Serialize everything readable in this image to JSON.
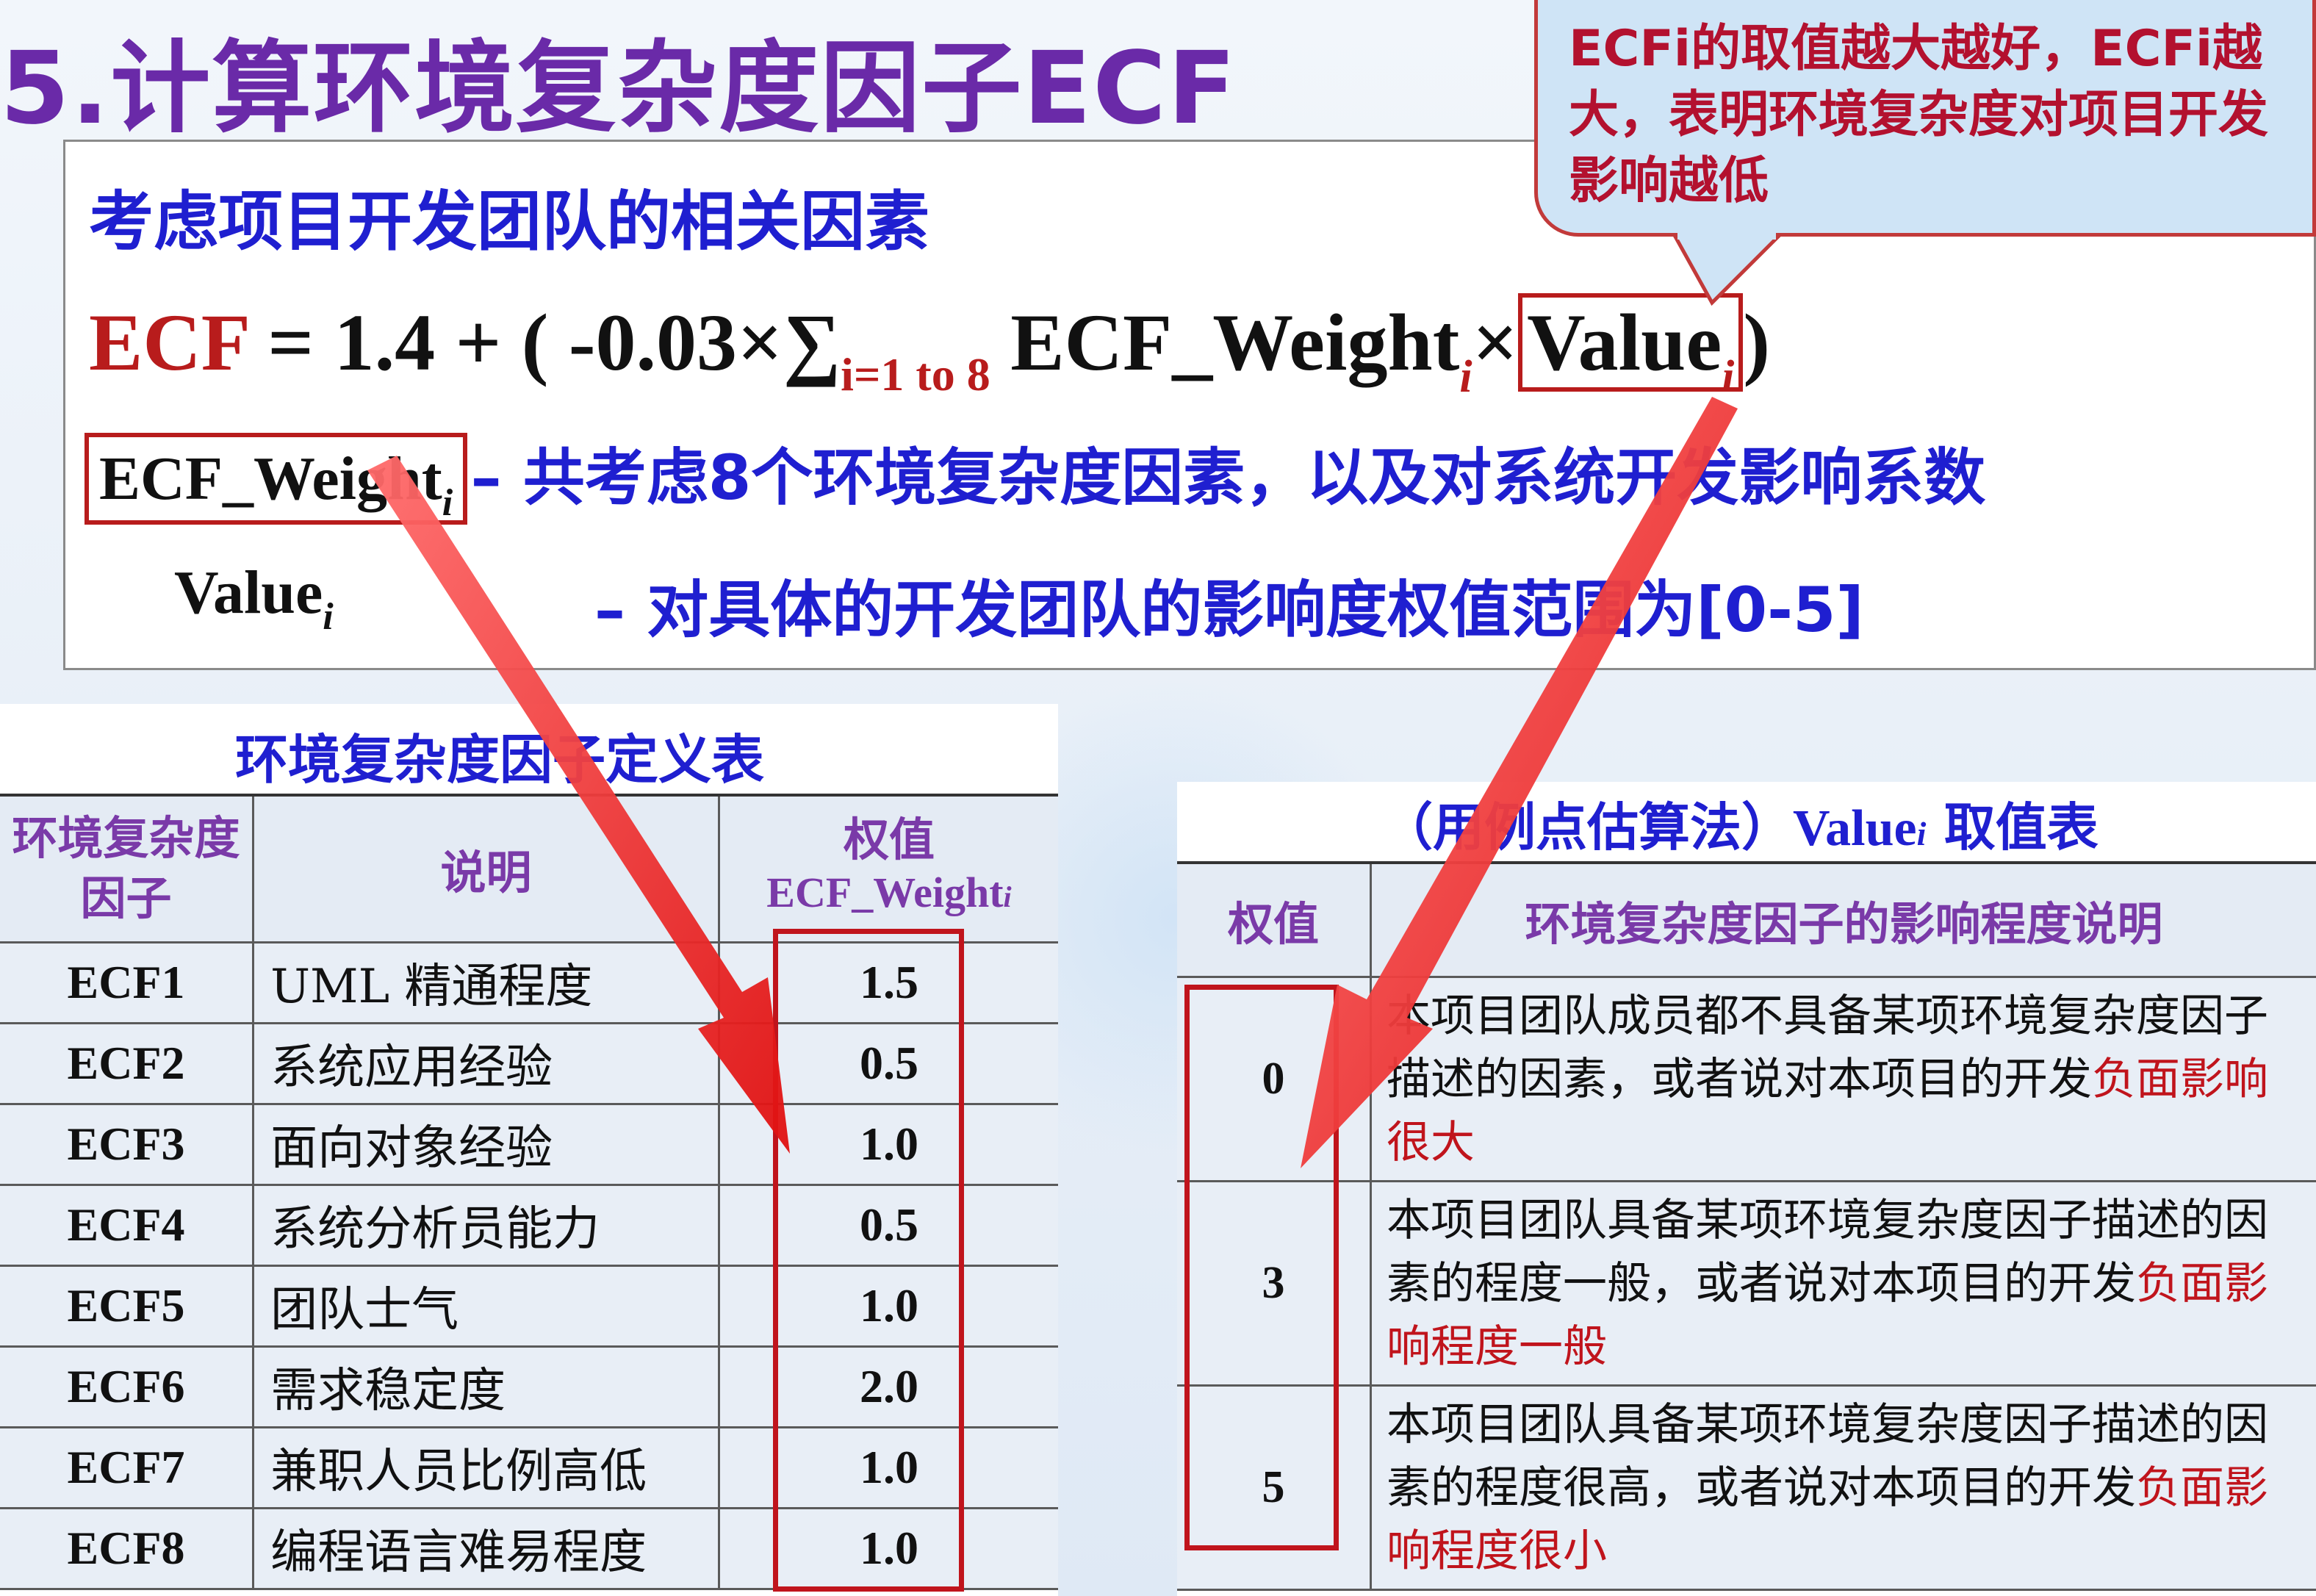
{
  "title": "5.计算环境复杂度因子ECF",
  "subtitle": "考虑项目开发团队的相关因素",
  "formula": {
    "lhs": "ECF",
    "eq": " = 1.4 + ( -0.03×∑",
    "sum_range": "i=1 to 8",
    "weight": " ECF_Weight",
    "times": "×",
    "value": "Value",
    "sub_i": "i",
    "close": ")"
  },
  "def1": {
    "term": "ECF_Weight",
    "sub": "i",
    "desc": "– 共考虑8个环境复杂度因素，以及对系统开发影响系数"
  },
  "def2": {
    "term": "Value",
    "sub": "i",
    "desc": "– 对具体的开发团队的影响度权值范围为[0-5]"
  },
  "callout": "ECFi的取值越大越好，ECFi越大，表明环境复杂度对项目开发影响越低",
  "table1": {
    "title": "环境复杂度因子定义表",
    "headers": {
      "factor": "环境复杂度因子",
      "desc": "说明",
      "weight": "权值",
      "weight_sub": "ECF_Weight",
      "weight_sub_i": "i"
    },
    "rows": [
      {
        "code": "ECF1",
        "desc": "UML 精通程度",
        "weight": "1.5"
      },
      {
        "code": "ECF2",
        "desc": "系统应用经验",
        "weight": "0.5"
      },
      {
        "code": "ECF3",
        "desc": "面向对象经验",
        "weight": "1.0"
      },
      {
        "code": "ECF4",
        "desc": "系统分析员能力",
        "weight": "0.5"
      },
      {
        "code": "ECF5",
        "desc": "团队士气",
        "weight": "1.0"
      },
      {
        "code": "ECF6",
        "desc": "需求稳定度",
        "weight": "2.0"
      },
      {
        "code": "ECF7",
        "desc": "兼职人员比例高低",
        "weight": "1.0"
      },
      {
        "code": "ECF8",
        "desc": "编程语言难易程度",
        "weight": "1.0"
      }
    ]
  },
  "table2": {
    "title_a": "（用例点估算法）",
    "title_b": "Value",
    "title_i": "i",
    "title_c": " 取值表",
    "headers": {
      "value": "权值",
      "desc": "环境复杂度因子的影响程度说明"
    },
    "rows": [
      {
        "value": "0",
        "desc": "本项目团队成员都不具备某项环境复杂度因子描述的因素，或者说对本项目的开发",
        "desc_red": "负面影响很大",
        "lead": ""
      },
      {
        "value": "3",
        "desc": "本项目团队具备某项环境复杂度因子描述的因素的程度一般，或者说对本项目的开发",
        "desc_red": "负面影响程度一般",
        "lead": ""
      },
      {
        "value": "5",
        "desc": "本项目团队具备某项环境复杂度因子描述的因素的程度很高，或者说对本项目的开发",
        "desc_red": "负面影响程度很小",
        "lead": ""
      }
    ]
  },
  "colors": {
    "title": "#6a2aa8",
    "blue": "#1f1fd0",
    "red": "#c0141c",
    "callout_bg": "#cfe4f6"
  }
}
